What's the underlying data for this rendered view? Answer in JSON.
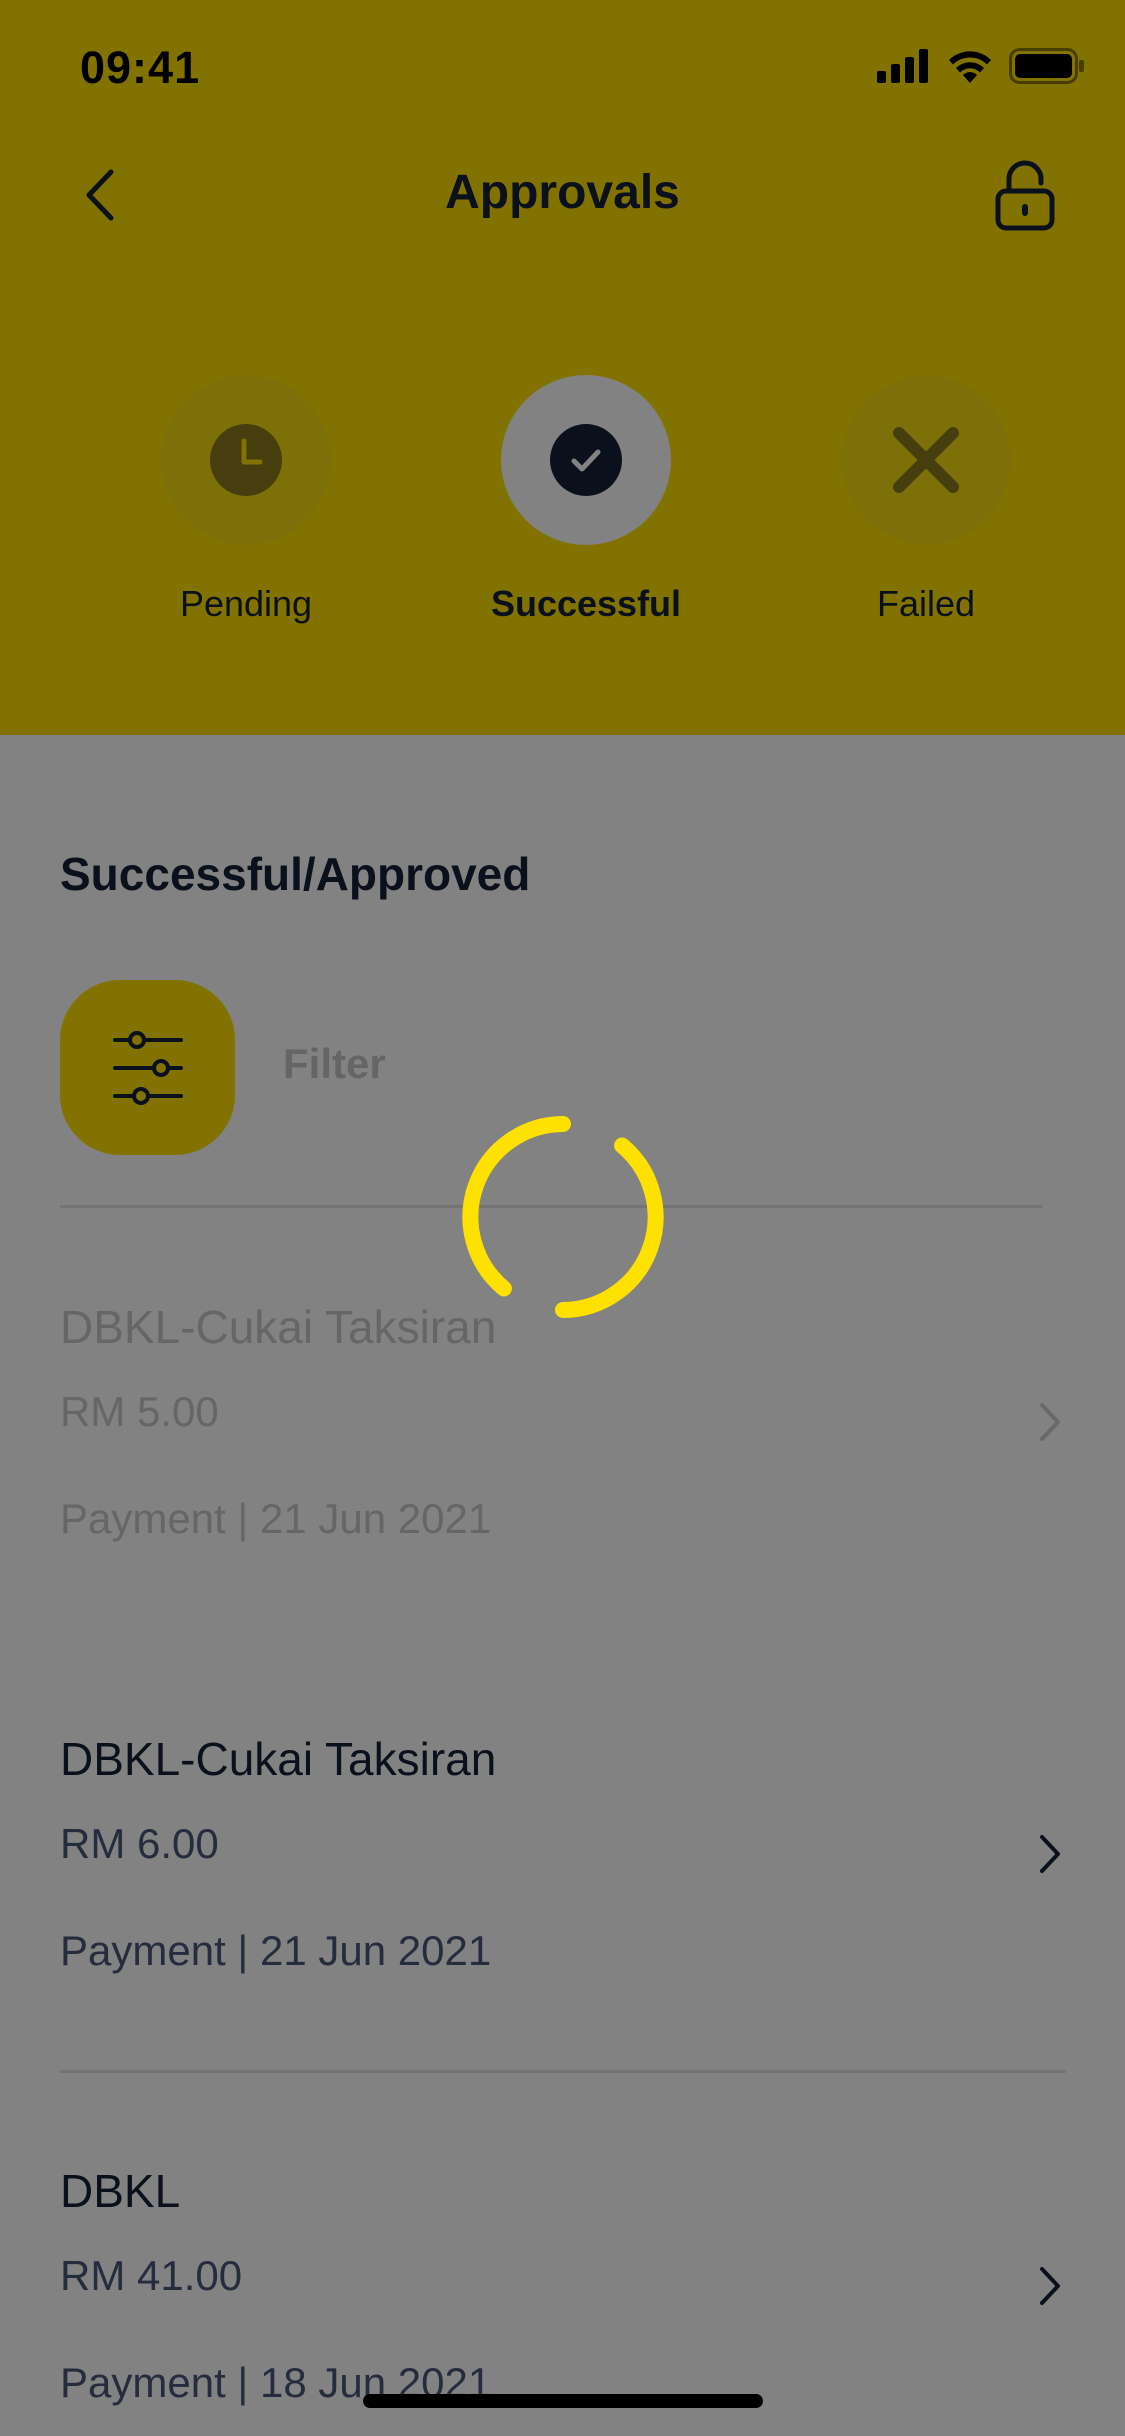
{
  "status_bar": {
    "time": "09:41",
    "icons": [
      "cellular-signal-icon",
      "wifi-icon",
      "battery-icon"
    ]
  },
  "nav": {
    "title": "Approvals",
    "back_icon": "chevron-left-icon",
    "lock_icon": "unlock-icon"
  },
  "tabs": [
    {
      "label": "Pending",
      "icon": "clock-icon",
      "active": false
    },
    {
      "label": "Successful",
      "icon": "check-circle-icon",
      "active": true
    },
    {
      "label": "Failed",
      "icon": "x-icon",
      "active": false
    }
  ],
  "section": {
    "title": "Successful/Approved",
    "filter_label": "Filter",
    "filter_icon": "sliders-icon"
  },
  "transactions": [
    {
      "name": "DBKL-Cukai Taksiran",
      "amount": "RM 5.00",
      "meta": "Payment | 21 Jun 2021"
    },
    {
      "name": "DBKL-Cukai Taksiran",
      "amount": "RM 6.00",
      "meta": "Payment | 21 Jun 2021"
    },
    {
      "name": "DBKL",
      "amount": "RM 41.00",
      "meta": "Payment | 18 Jun 2021"
    }
  ],
  "loading": {
    "spinner_icon": "loading-spinner-icon"
  },
  "colors": {
    "brand_yellow": "#FFE100",
    "text_dark": "#16213a",
    "text_muted": "#4a5678",
    "overlay": "rgba(0,0,0,0.49)"
  }
}
